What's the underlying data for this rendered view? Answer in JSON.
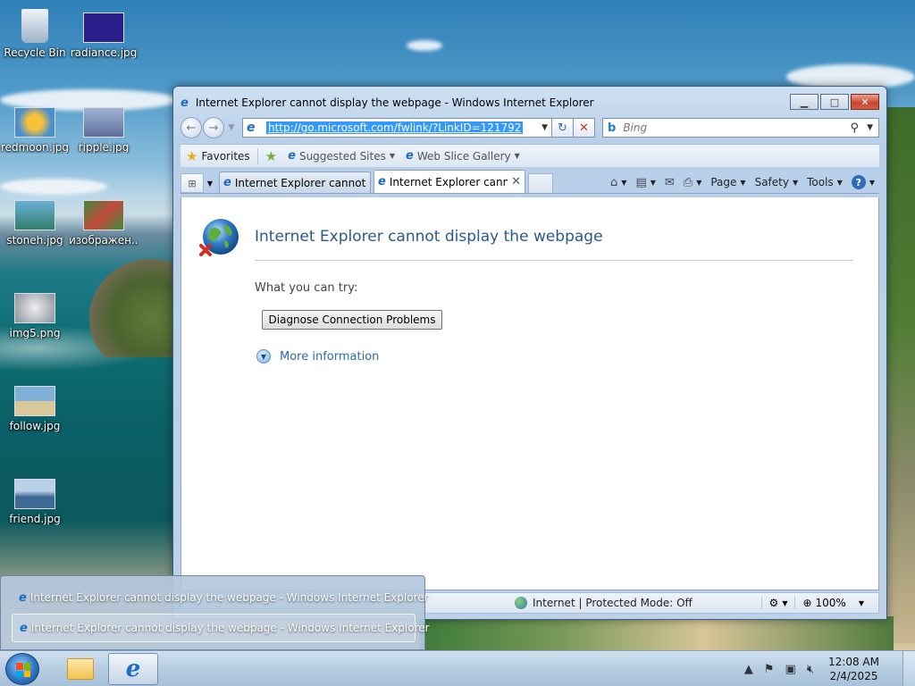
{
  "desktop": {
    "icons": [
      {
        "label": "Recycle Bin",
        "icon": "recycle-bin-icon",
        "color": "#cfd8e2"
      },
      {
        "label": "radiance.jpg",
        "icon": "image-file-icon",
        "color": "#2a1f8a"
      },
      {
        "label": "redmoon.jpg",
        "icon": "image-file-icon",
        "color": "#e79a2a"
      },
      {
        "label": "ripple.jpg",
        "icon": "image-file-icon",
        "color": "#9fb2d6"
      },
      {
        "label": "stoneh.jpg",
        "icon": "image-file-icon",
        "color": "#3d8a6a"
      },
      {
        "label": "изображен...",
        "icon": "image-file-icon",
        "color": "#b84a3a"
      },
      {
        "label": "img5.png",
        "icon": "image-file-icon",
        "color": "#c9ced6"
      },
      {
        "label": "follow.jpg",
        "icon": "image-file-icon",
        "color": "#7fb0d8"
      },
      {
        "label": "friend.jpg",
        "icon": "image-file-icon",
        "color": "#6a8fb8"
      }
    ]
  },
  "window": {
    "title": "Internet Explorer cannot display the webpage - Windows Internet Explorer",
    "minimize": "▁",
    "maximize": "□",
    "close": "✕"
  },
  "nav": {
    "back": "←",
    "forward": "→",
    "dropdown": "▼",
    "address": "http://go.microsoft.com/fwlink/?LinkID=121792",
    "refresh": "↻",
    "stop": "✕",
    "search_placeholder": "Bing",
    "search_logo": "b",
    "search_icon": "⚲"
  },
  "favorites_bar": {
    "favorites": "Favorites",
    "suggested_sites": "Suggested Sites",
    "web_slice_gallery": "Web Slice Gallery"
  },
  "tabs": [
    {
      "label": "Internet Explorer cannot ..."
    },
    {
      "label": "Internet Explorer cann...",
      "active": true,
      "close": "✕"
    }
  ],
  "commands": {
    "home": "⌂",
    "feeds": "▤",
    "mail": "✉",
    "print": "⎙",
    "page": "Page",
    "safety": "Safety",
    "tools": "Tools",
    "help": "?"
  },
  "page": {
    "title": "Internet Explorer cannot display the webpage",
    "try_text": "What you can try:",
    "diagnose_button": "Diagnose Connection Problems",
    "more_information": "More information"
  },
  "status": {
    "zone": "Internet | Protected Mode: Off",
    "zoom": "100%"
  },
  "taskbar_popup": {
    "items": [
      {
        "label": "Internet Explorer cannot display the webpage - Windows Internet Explorer"
      },
      {
        "label": "Internet Explorer cannot display the webpage - Windows Internet Explorer",
        "selected": true
      }
    ]
  },
  "taskbar": {
    "time": "12:08 AM",
    "date": "2/4/2025"
  },
  "colors": {
    "link": "#2a6db0",
    "title_blue": "#2a5a8a",
    "selection": "#3399ff"
  }
}
